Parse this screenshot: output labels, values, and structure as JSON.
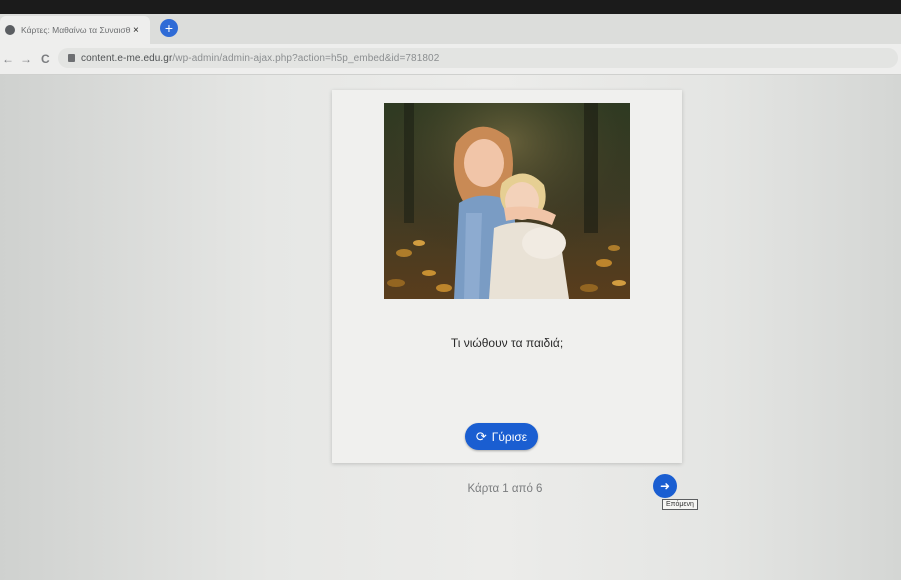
{
  "browser": {
    "tab_title": "Κάρτες: Μαθαίνω τα Συναισθή...",
    "tab_close": "×",
    "new_tab": "+",
    "back": "←",
    "forward": "→",
    "reload": "C",
    "url_host": "content.e-me.edu.gr",
    "url_path": "/wp-admin/admin-ajax.php?action=h5p_embed&id=781802"
  },
  "card": {
    "image_icon": "photo-two-girls-hugging",
    "question": "Τι νιώθουν τα παιδιά;",
    "flip_icon": "refresh-icon",
    "flip_label": "Γύρισε"
  },
  "navigation": {
    "counter": "Κάρτα 1 από 6",
    "next_icon": "arrow-right-icon",
    "next_tooltip": "Επόμενη"
  },
  "colors": {
    "accent": "#1a5ed1"
  }
}
